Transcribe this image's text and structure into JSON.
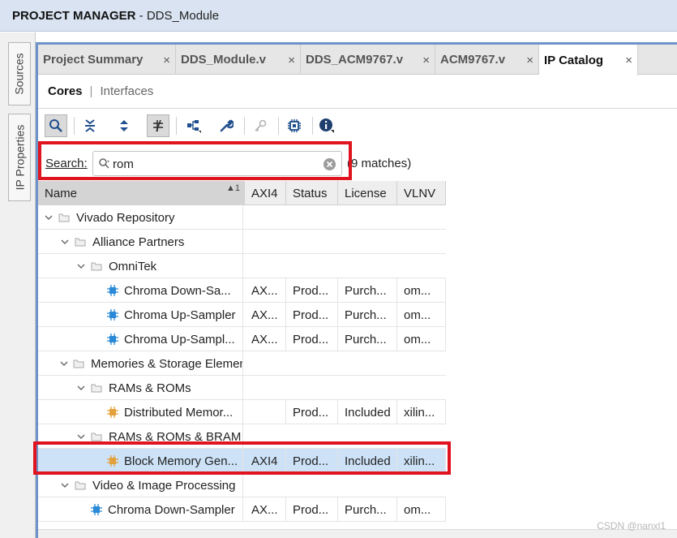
{
  "window": {
    "title_bold": "PROJECT MANAGER",
    "title_rest": " - DDS_Module"
  },
  "side_tabs": {
    "sources": "Sources",
    "ip_properties": "IP Properties"
  },
  "tabs": [
    {
      "label": "Project Summary",
      "close": "×"
    },
    {
      "label": "DDS_Module.v",
      "close": "×"
    },
    {
      "label": "DDS_ACM9767.v",
      "close": "×"
    },
    {
      "label": "ACM9767.v",
      "close": "×"
    },
    {
      "label": "IP Catalog",
      "close": "×"
    }
  ],
  "subtabs": {
    "cores": "Cores",
    "separator": "|",
    "interfaces": "Interfaces"
  },
  "search": {
    "label": "Search:",
    "value": "rom",
    "matches": "(9 matches)"
  },
  "table": {
    "columns": {
      "name": "Name",
      "sort_indicator": "1",
      "axi4": "AXI4",
      "status": "Status",
      "license": "License",
      "vlnv": "VLNV"
    },
    "rows": [
      {
        "name": "Vivado Repository",
        "axi4": "",
        "status": "",
        "license": "",
        "vlnv": ""
      },
      {
        "name": "Alliance Partners",
        "axi4": "",
        "status": "",
        "license": "",
        "vlnv": ""
      },
      {
        "name": "OmniTek",
        "axi4": "",
        "status": "",
        "license": "",
        "vlnv": ""
      },
      {
        "name": "Chroma Down-Sa...",
        "axi4": "AX...",
        "status": "Prod...",
        "license": "Purch...",
        "vlnv": "om..."
      },
      {
        "name": "Chroma Up-Sampler",
        "axi4": "AX...",
        "status": "Prod...",
        "license": "Purch...",
        "vlnv": "om..."
      },
      {
        "name": "Chroma Up-Sampl...",
        "axi4": "AX...",
        "status": "Prod...",
        "license": "Purch...",
        "vlnv": "om..."
      },
      {
        "name": "Memories & Storage Elements",
        "axi4": "",
        "status": "",
        "license": "",
        "vlnv": ""
      },
      {
        "name": "RAMs & ROMs",
        "axi4": "",
        "status": "",
        "license": "",
        "vlnv": ""
      },
      {
        "name": "Distributed Memor...",
        "axi4": "",
        "status": "Prod...",
        "license": "Included",
        "vlnv": "xilin..."
      },
      {
        "name": "RAMs & ROMs & BRAM",
        "axi4": "",
        "status": "",
        "license": "",
        "vlnv": ""
      },
      {
        "name": "Block Memory Gen...",
        "axi4": "AXI4",
        "status": "Prod...",
        "license": "Included",
        "vlnv": "xilin..."
      },
      {
        "name": "Video & Image Processing",
        "axi4": "",
        "status": "",
        "license": "",
        "vlnv": ""
      },
      {
        "name": "Chroma Down-Sampler",
        "axi4": "AX...",
        "status": "Prod...",
        "license": "Purch...",
        "vlnv": "om..."
      }
    ]
  },
  "watermark": "CSDN @nanxl1",
  "colors": {
    "title_bg": "#d9e3f1",
    "panel_border": "#6e93c9",
    "highlight": "#e0141e",
    "selected_row": "#cde2f7",
    "ip_icon_blue": "#2b8ad8",
    "ip_icon_orange": "#e3a13b"
  },
  "icons": {
    "toolbar": [
      "search-icon",
      "collapse-all-icon",
      "expand-all-icon",
      "filter-toggle-icon",
      "hierarchy-icon",
      "wrench-icon",
      "key-icon",
      "chip-icon",
      "info-icon"
    ],
    "tree": [
      "chevron-down-icon",
      "folder-icon",
      "ip-core-icon"
    ],
    "search": [
      "magnifier-icon",
      "clear-icon"
    ]
  }
}
